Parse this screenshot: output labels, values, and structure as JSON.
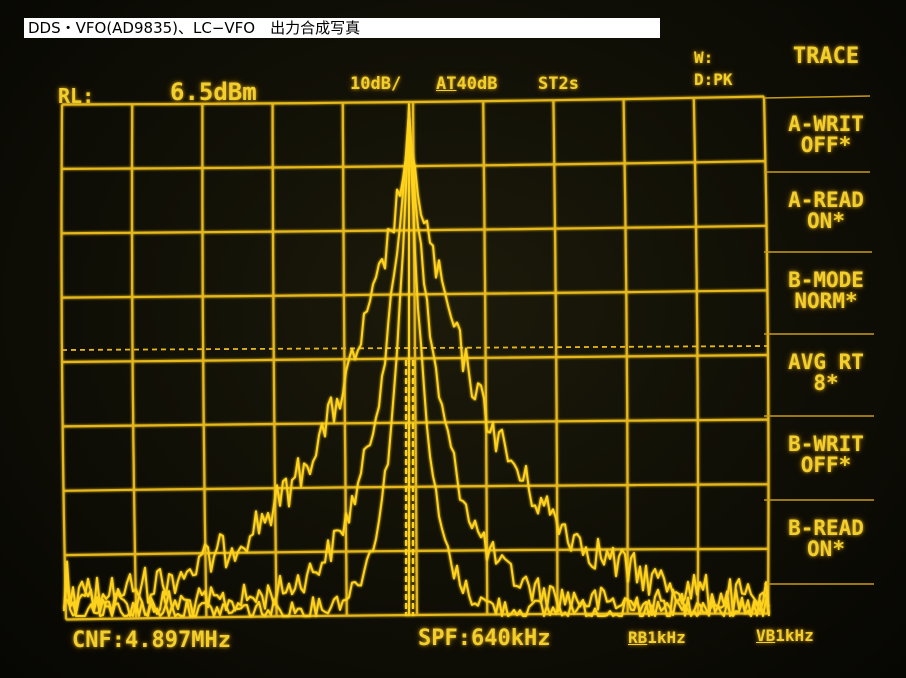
{
  "caption": "DDS・VFO(AD9835)、LC−VFO　出力合成写真",
  "colors": {
    "trace": "#ffd21f",
    "text": "#f2cf2a",
    "background": "#0c0b05"
  },
  "header": {
    "rl_label": "RL:",
    "rl_value": "6.5dBm",
    "scale": "10dB/",
    "atten_prefix": "AT",
    "atten_value": "40dB",
    "sweep": "ST2s",
    "w_label": "W:",
    "d_label": "D:PK"
  },
  "menu": {
    "title": "TRACE",
    "items": [
      {
        "line1": "A-WRIT",
        "line2": "OFF*"
      },
      {
        "line1": "A-READ",
        "line2": "ON*"
      },
      {
        "line1": "B-MODE",
        "line2": "NORM*"
      },
      {
        "line1": "AVG RT",
        "line2": "8*"
      },
      {
        "line1": "B-WRIT",
        "line2": "OFF*"
      },
      {
        "line1": "B-READ",
        "line2": "ON*"
      }
    ]
  },
  "footer": {
    "center_freq": "CNF:4.897MHz",
    "span": "SPF:640kHz",
    "rbw_prefix": "RB",
    "rbw_value": "1kHz",
    "vbw_prefix": "VB",
    "vbw_value": "1kHz"
  }
}
